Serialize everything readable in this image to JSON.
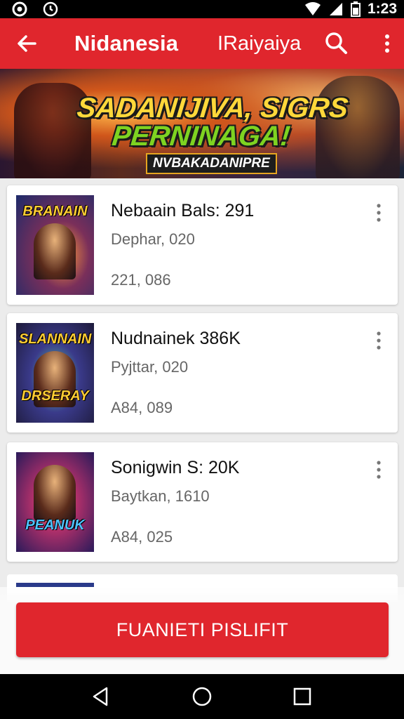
{
  "status_bar": {
    "time": "1:23"
  },
  "app_bar": {
    "title": "Nidanesia",
    "subtitle": "IRaiyaiya"
  },
  "banner": {
    "title_line1": "SADANIJIVA, SIGRS",
    "title_line2": "PERNINAGA!",
    "tag": "NVBAKADANIPRE"
  },
  "items": [
    {
      "title": "Nebaain Bals: 291",
      "subtitle": "Dephar, 020",
      "meta": "221, 086",
      "thumb_top": "BRANAIN",
      "thumb_bottom": ""
    },
    {
      "title": "Nudnainek 386K",
      "subtitle": "Pyjttar, 020",
      "meta": "A84, 089",
      "thumb_top": "SLANNAIN",
      "thumb_bottom": "DRSERAY"
    },
    {
      "title": "Sonigwin S: 20K",
      "subtitle": "Baytkan, 1610",
      "meta": "A84, 025",
      "thumb_top": "",
      "thumb_bottom": "PEANUK"
    }
  ],
  "action_button": {
    "label": "FUANIETI PISLIFIT"
  },
  "colors": {
    "primary": "#e0262d",
    "card": "#ffffff",
    "background": "#ececec"
  }
}
